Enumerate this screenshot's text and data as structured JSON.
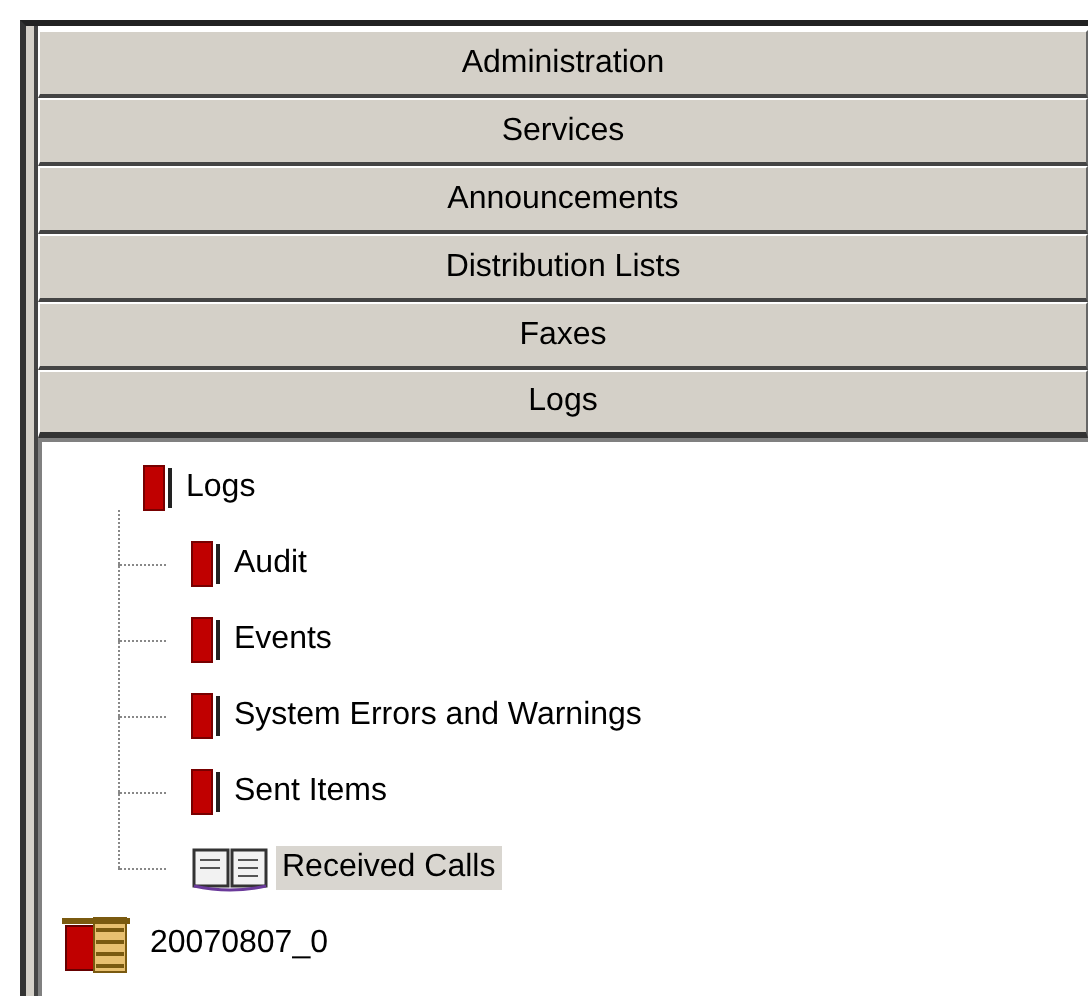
{
  "sections": [
    {
      "label": "Administration",
      "selected": false
    },
    {
      "label": "Services",
      "selected": false
    },
    {
      "label": "Announcements",
      "selected": false
    },
    {
      "label": "Distribution Lists",
      "selected": false
    },
    {
      "label": "Faxes",
      "selected": false
    },
    {
      "label": "Logs",
      "selected": true
    }
  ],
  "tree": [
    {
      "label": "Logs",
      "kind": "book",
      "selected": false,
      "children": [
        {
          "label": "Audit",
          "kind": "book",
          "selected": false
        },
        {
          "label": "Events",
          "kind": "book",
          "selected": false
        },
        {
          "label": "System Errors and Warnings",
          "kind": "book",
          "selected": false
        },
        {
          "label": "Sent Items",
          "kind": "book",
          "selected": false
        },
        {
          "label": "Received Calls",
          "kind": "open-book",
          "selected": true
        }
      ]
    },
    {
      "label": "20070807_0",
      "kind": "archive",
      "selected": false
    }
  ]
}
